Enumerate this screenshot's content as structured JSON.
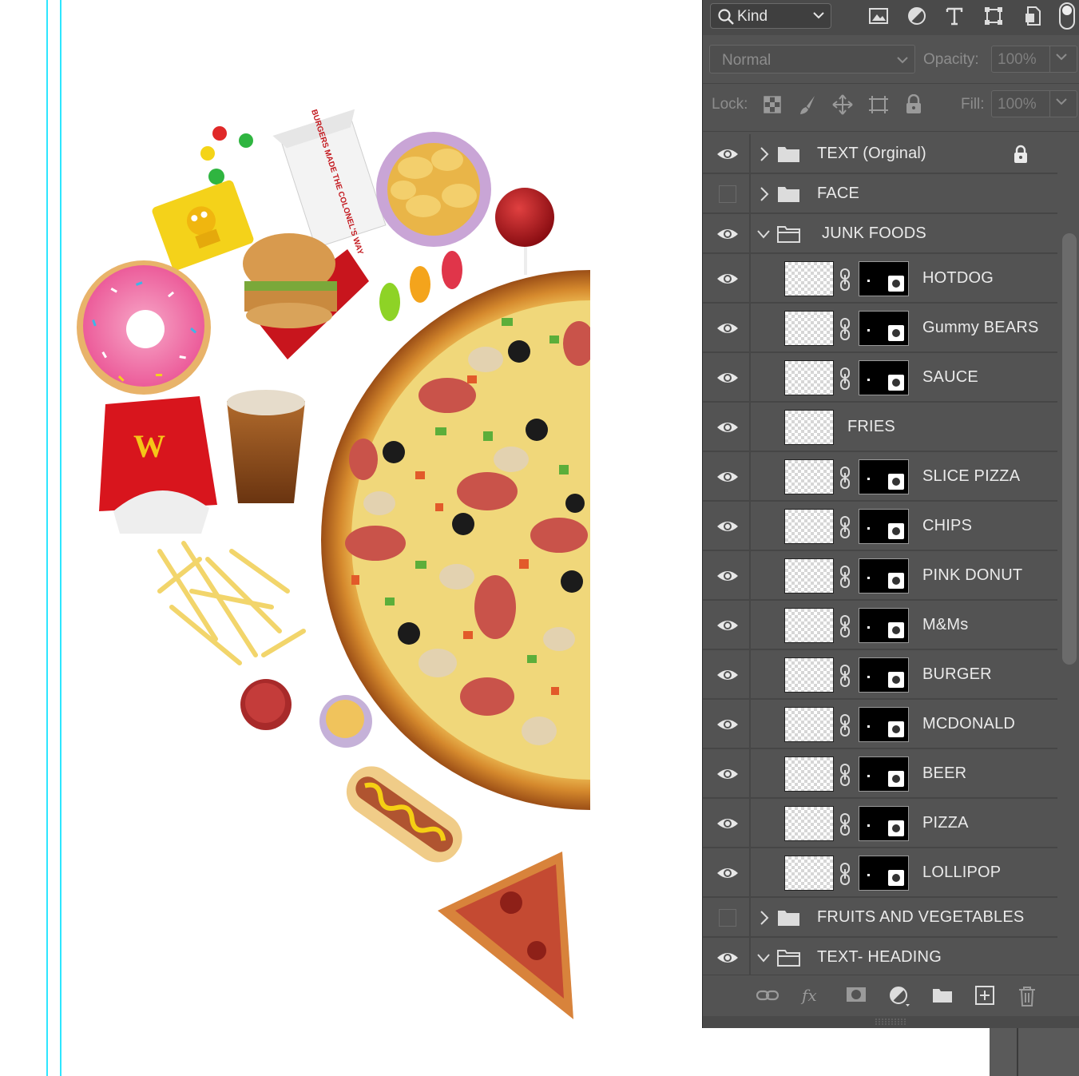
{
  "panel": {
    "filter": {
      "label": "Kind"
    },
    "blend_mode": "Normal",
    "opacity": {
      "label": "Opacity:",
      "value": "100%"
    },
    "lock": {
      "label": "Lock:"
    },
    "fill": {
      "label": "Fill:",
      "value": "100%"
    }
  },
  "layers": [
    {
      "name": "TEXT (Orginal)",
      "type": "group",
      "visible": true,
      "expanded": false,
      "locked": true
    },
    {
      "name": "FACE",
      "type": "group",
      "visible": false,
      "expanded": false
    },
    {
      "name": "JUNK FOODS",
      "type": "group",
      "visible": true,
      "expanded": true
    },
    {
      "name": "HOTDOG",
      "type": "layer",
      "visible": true,
      "mask": true
    },
    {
      "name": "Gummy BEARS",
      "type": "layer",
      "visible": true,
      "mask": true
    },
    {
      "name": "SAUCE",
      "type": "layer",
      "visible": true,
      "mask": true
    },
    {
      "name": "FRIES",
      "type": "layer",
      "visible": true,
      "mask": false
    },
    {
      "name": "SLICE PIZZA",
      "type": "layer",
      "visible": true,
      "mask": true
    },
    {
      "name": "CHIPS",
      "type": "layer",
      "visible": true,
      "mask": true
    },
    {
      "name": "PINK DONUT",
      "type": "layer",
      "visible": true,
      "mask": true
    },
    {
      "name": "M&Ms",
      "type": "layer",
      "visible": true,
      "mask": true
    },
    {
      "name": "BURGER",
      "type": "layer",
      "visible": true,
      "mask": true
    },
    {
      "name": "MCDONALD",
      "type": "layer",
      "visible": true,
      "mask": true
    },
    {
      "name": "BEER",
      "type": "layer",
      "visible": true,
      "mask": true
    },
    {
      "name": "PIZZA",
      "type": "layer",
      "visible": true,
      "mask": true
    },
    {
      "name": "LOLLIPOP",
      "type": "layer",
      "visible": true,
      "mask": true
    },
    {
      "name": "FRUITS AND VEGETABLES",
      "type": "group",
      "visible": false,
      "expanded": false
    },
    {
      "name": "TEXT- HEADING",
      "type": "group",
      "visible": true,
      "expanded": true
    }
  ],
  "canvas": {
    "box_text": "BURGERS MADE THE COLONEL'S WAY",
    "fries_logo": "W"
  },
  "colors": {
    "panel_bg": "#535353",
    "guide": "#2ee6ff",
    "text": "#eaeaea"
  }
}
